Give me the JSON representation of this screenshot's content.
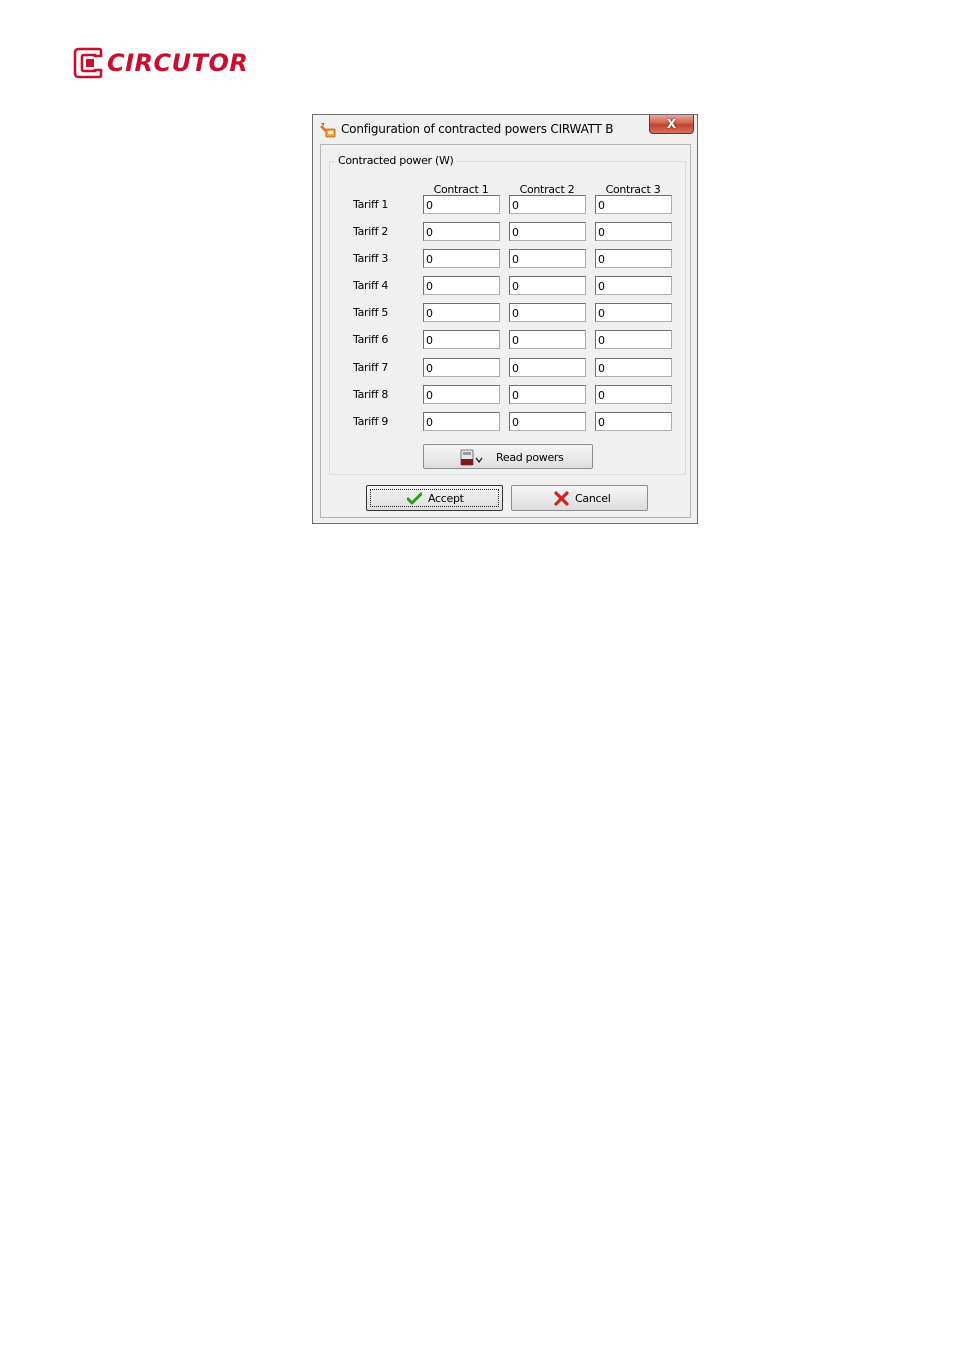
{
  "logo": {
    "text": "CIRCUTOR",
    "brand_color": "#c8102e"
  },
  "window": {
    "title": "Configuration of contracted powers CIRWATT B",
    "close_label": "X",
    "icon": "wrench-config-icon"
  },
  "group": {
    "label": "Contracted power (W)",
    "columns": [
      "Contract 1",
      "Contract 2",
      "Contract 3"
    ],
    "rows": [
      {
        "label": "Tariff 1",
        "values": [
          "0",
          "0",
          "0"
        ]
      },
      {
        "label": "Tariff 2",
        "values": [
          "0",
          "0",
          "0"
        ]
      },
      {
        "label": "Tariff 3",
        "values": [
          "0",
          "0",
          "0"
        ]
      },
      {
        "label": "Tariff 4",
        "values": [
          "0",
          "0",
          "0"
        ]
      },
      {
        "label": "Tariff 5",
        "values": [
          "0",
          "0",
          "0"
        ]
      },
      {
        "label": "Tariff 6",
        "values": [
          "0",
          "0",
          "0"
        ]
      },
      {
        "label": "Tariff 7",
        "values": [
          "0",
          "0",
          "0"
        ]
      },
      {
        "label": "Tariff 8",
        "values": [
          "0",
          "0",
          "0"
        ]
      },
      {
        "label": "Tariff 9",
        "values": [
          "0",
          "0",
          "0"
        ]
      }
    ],
    "read_button": {
      "label": "Read powers",
      "icon": "meter-download-icon"
    }
  },
  "buttons": {
    "accept": {
      "label": "Accept",
      "icon": "checkmark-icon",
      "icon_color": "#2e9a1a"
    },
    "cancel": {
      "label": "Cancel",
      "icon": "cross-icon",
      "icon_color": "#d42020"
    }
  }
}
